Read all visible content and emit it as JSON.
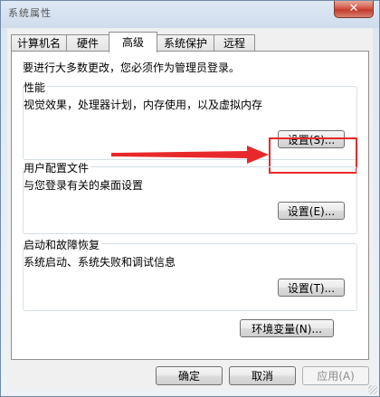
{
  "window": {
    "title": "系统属性",
    "close_label": "✕"
  },
  "tabs": [
    {
      "label": "计算机名"
    },
    {
      "label": "硬件"
    },
    {
      "label": "高级"
    },
    {
      "label": "系统保护"
    },
    {
      "label": "远程"
    }
  ],
  "panel": {
    "admin_note": "要进行大多数更改，您必须作为管理员登录。",
    "performance": {
      "title": "性能",
      "desc": "视觉效果，处理器计划，内存使用，以及虚拟内存",
      "button": "设置(S)..."
    },
    "user_profiles": {
      "title": "用户配置文件",
      "desc": "与您登录有关的桌面设置",
      "button": "设置(E)..."
    },
    "startup_recovery": {
      "title": "启动和故障恢复",
      "desc": "系统启动、系统失败和调试信息",
      "button": "设置(T)..."
    },
    "env_button": "环境变量(N)..."
  },
  "footer": {
    "ok": "确定",
    "cancel": "取消",
    "apply": "应用(A)"
  },
  "colors": {
    "annotation": "#e8292b"
  }
}
